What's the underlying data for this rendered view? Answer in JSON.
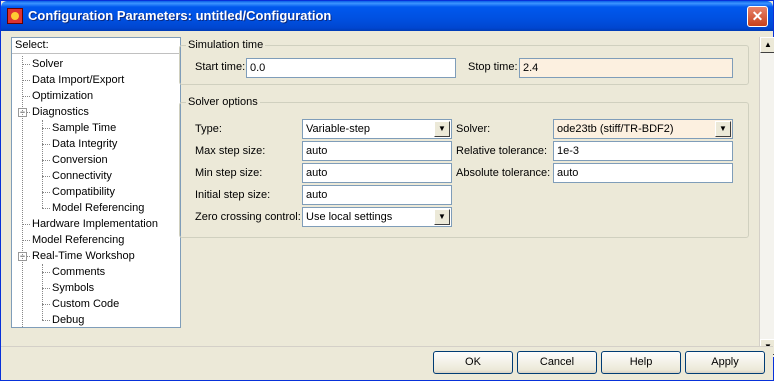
{
  "window": {
    "title": "Configuration Parameters: untitled/Configuration",
    "close_glyph": "✕"
  },
  "tree": {
    "header": "Select:",
    "items": [
      {
        "label": "Solver",
        "level": 1,
        "selected": true
      },
      {
        "label": "Data Import/Export",
        "level": 1
      },
      {
        "label": "Optimization",
        "level": 1
      },
      {
        "label": "Diagnostics",
        "level": 1,
        "expanded": true
      },
      {
        "label": "Sample Time",
        "level": 2
      },
      {
        "label": "Data Integrity",
        "level": 2
      },
      {
        "label": "Conversion",
        "level": 2
      },
      {
        "label": "Connectivity",
        "level": 2
      },
      {
        "label": "Compatibility",
        "level": 2
      },
      {
        "label": "Model Referencing",
        "level": 2
      },
      {
        "label": "Hardware Implementation",
        "level": 1
      },
      {
        "label": "Model Referencing",
        "level": 1
      },
      {
        "label": "Real-Time Workshop",
        "level": 1,
        "expanded": true
      },
      {
        "label": "Comments",
        "level": 2
      },
      {
        "label": "Symbols",
        "level": 2
      },
      {
        "label": "Custom Code",
        "level": 2
      },
      {
        "label": "Debug",
        "level": 2
      }
    ]
  },
  "simulation_time": {
    "legend": "Simulation time",
    "start_label": "Start time:",
    "start_value": "0.0",
    "stop_label": "Stop time:",
    "stop_value": "2.4"
  },
  "solver_options": {
    "legend": "Solver options",
    "type_label": "Type:",
    "type_value": "Variable-step",
    "solver_label": "Solver:",
    "solver_value": "ode23tb (stiff/TR-BDF2)",
    "max_step_label": "Max step size:",
    "max_step_value": "auto",
    "rel_tol_label": "Relative tolerance:",
    "rel_tol_value": "1e-3",
    "min_step_label": "Min step size:",
    "min_step_value": "auto",
    "abs_tol_label": "Absolute tolerance:",
    "abs_tol_value": "auto",
    "init_step_label": "Initial step size:",
    "init_step_value": "auto",
    "zero_cross_label": "Zero crossing control:",
    "zero_cross_value": "Use local settings"
  },
  "buttons": {
    "ok": "OK",
    "cancel": "Cancel",
    "help": "Help",
    "apply": "Apply"
  },
  "scroll_glyphs": {
    "up": "▲",
    "down": "▼",
    "left": "◀",
    "right": "▶",
    "combo": "▼"
  },
  "colors": {
    "titlebar": "#0058ee",
    "dialog_bg": "#ece9d8",
    "readonly_field": "#fcf0e0"
  }
}
